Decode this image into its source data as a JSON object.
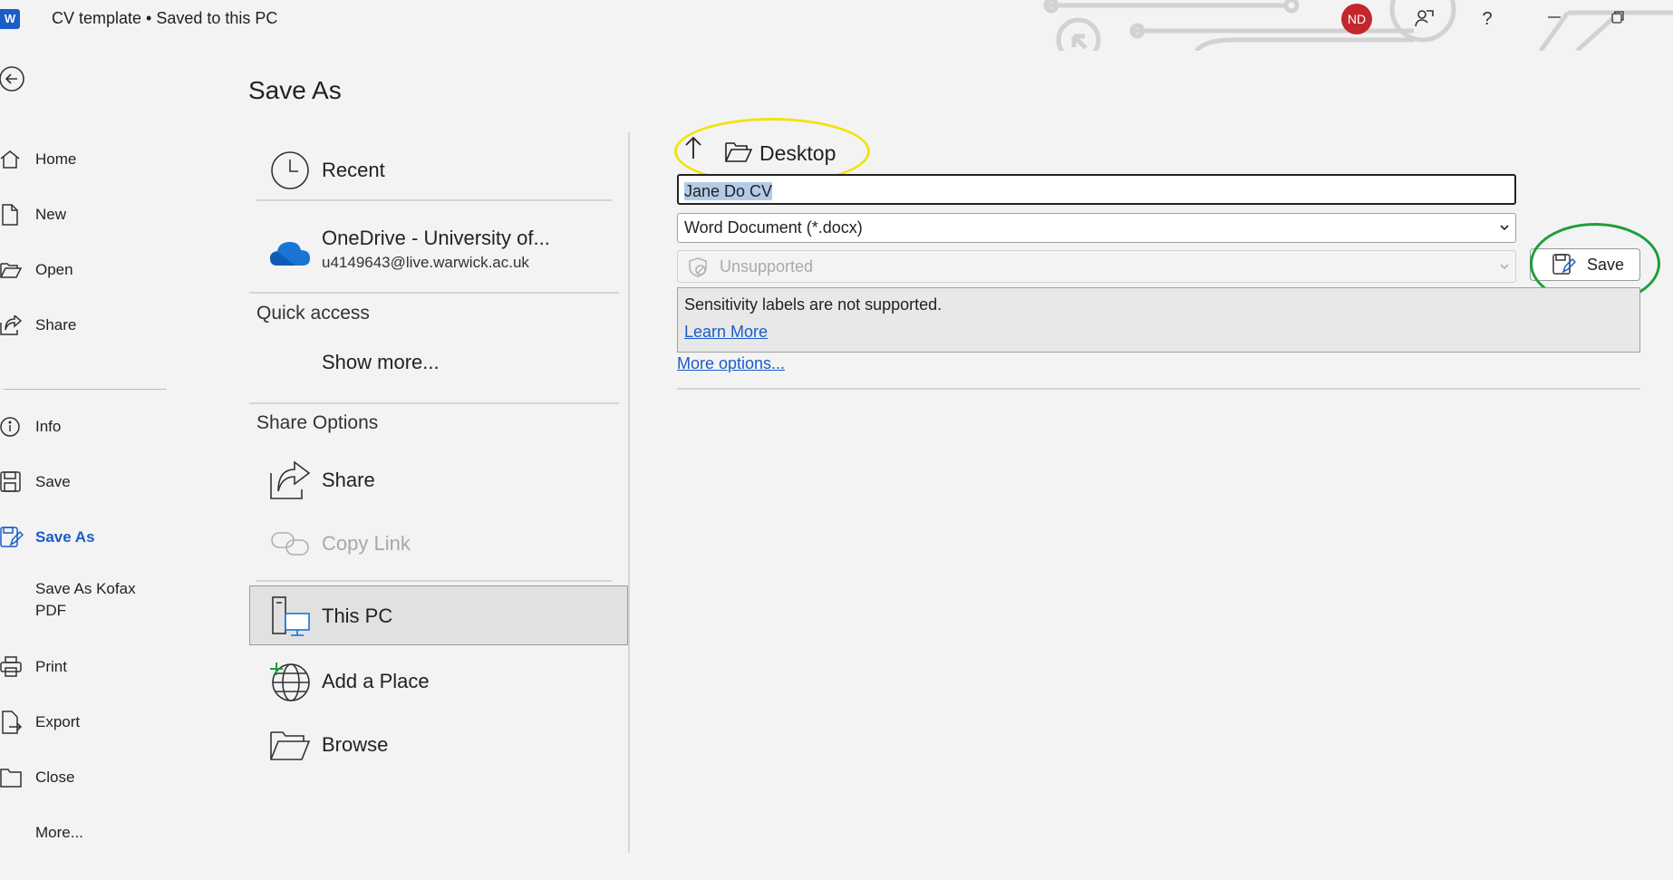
{
  "titlebar": {
    "app_letter": "W",
    "doc_title": "CV template • Saved to this PC",
    "avatar_initials": "ND",
    "help_label": "?"
  },
  "nav": {
    "back": "back-arrow",
    "items": [
      {
        "label": "Home",
        "icon": "home-icon"
      },
      {
        "label": "New",
        "icon": "new-document-icon"
      },
      {
        "label": "Open",
        "icon": "open-folder-icon"
      },
      {
        "label": "Share",
        "icon": "share-icon"
      },
      {
        "label": "Info",
        "icon": "info-icon"
      },
      {
        "label": "Save",
        "icon": "save-icon"
      },
      {
        "label": "Save As",
        "icon": "save-as-icon",
        "active": true
      },
      {
        "label": "Save As Kofax PDF",
        "icon": ""
      },
      {
        "label": "Print",
        "icon": "print-icon"
      },
      {
        "label": "Export",
        "icon": "export-icon"
      },
      {
        "label": "Close",
        "icon": "close-folder-icon"
      },
      {
        "label": "More...",
        "icon": ""
      }
    ]
  },
  "main": {
    "title": "Save As",
    "locations": {
      "recent": "Recent",
      "onedrive_name": "OneDrive - University of...",
      "onedrive_email": "u4149643@live.warwick.ac.uk",
      "quick_access": "Quick access",
      "show_more": "Show more...",
      "share_options": "Share Options",
      "share": "Share",
      "copy_link": "Copy Link",
      "this_pc": "This PC",
      "add_place": "Add a Place",
      "browse": "Browse"
    },
    "panel": {
      "folder": "Desktop",
      "filename": "Jane Do CV",
      "filetype": "Word Document (*.docx)",
      "sensitivity": "Unsupported",
      "save_label": "Save",
      "notice": "Sensitivity labels are not supported.",
      "learn_more": "Learn More",
      "more_options": "More options..."
    },
    "colors": {
      "accent": "#1a5dc8",
      "highlight_yellow": "#f0e30f",
      "highlight_green": "#1e9e3a",
      "avatar": "#c4262e"
    }
  }
}
